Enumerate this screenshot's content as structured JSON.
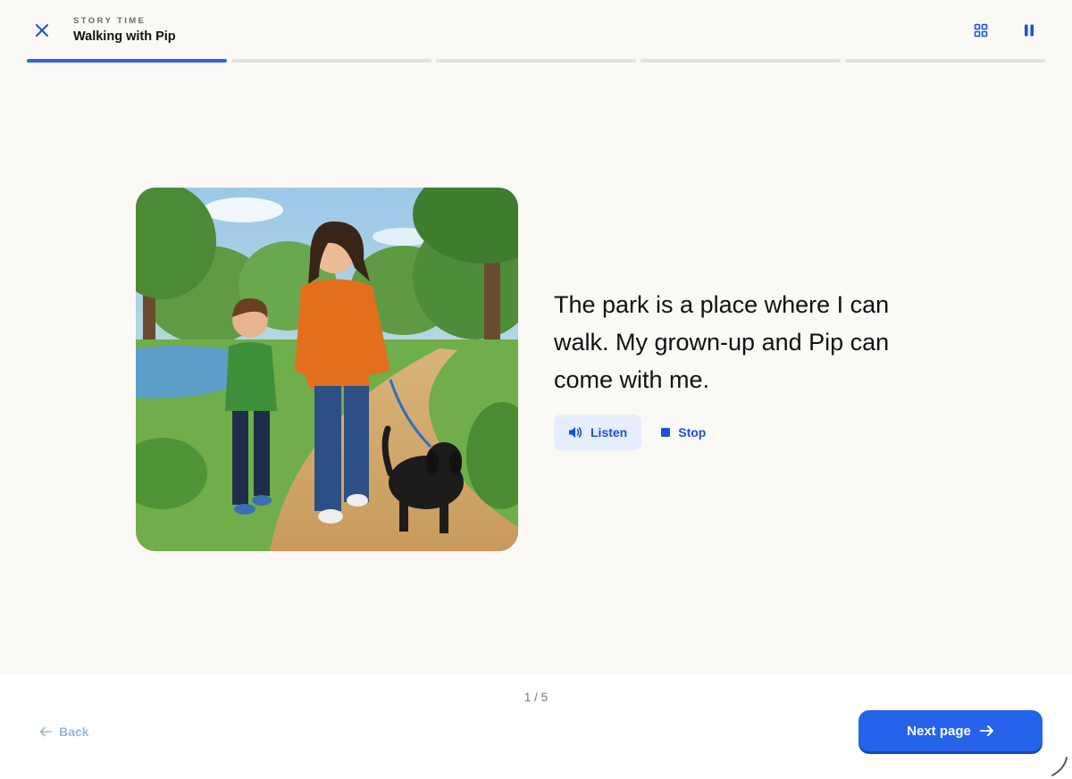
{
  "header": {
    "eyebrow": "STORY TIME",
    "title": "Walking with Pip",
    "close_icon": "close-icon",
    "grid_icon": "grid-icon",
    "pause_icon": "pause-icon"
  },
  "progress": {
    "total_pages": 5,
    "current_page": 1,
    "segment_fill": [
      1,
      0,
      0,
      0,
      0
    ]
  },
  "page": {
    "text": "The park is a place where I can walk. My grown-up and Pip can come with me.",
    "illustration_icon": "story-illustration"
  },
  "audio": {
    "listen_label": "Listen",
    "stop_label": "Stop",
    "listen_icon": "speaker-icon",
    "stop_icon": "stop-icon"
  },
  "footer": {
    "page_counter": "1 / 5",
    "back_label": "Back",
    "next_label": "Next page"
  },
  "colors": {
    "accent": "#2563eb",
    "accent_dark": "#1d4fd8",
    "background": "#faf9f6",
    "footer_bg": "#ffffff",
    "progress_track": "#e2e1de"
  }
}
